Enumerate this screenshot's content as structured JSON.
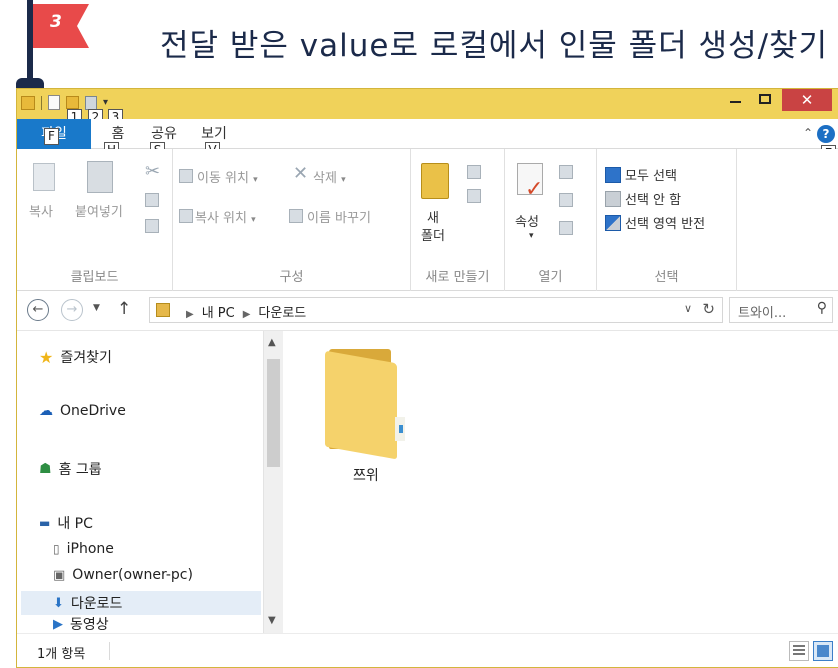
{
  "banner": {
    "step": "3",
    "title": "전달 받은 value로 로컬에서 인물 폴더 생성/찾기"
  },
  "qat": {
    "keytips": [
      "1",
      "2",
      "3"
    ]
  },
  "window_controls": {
    "close_glyph": "✕"
  },
  "tabs": {
    "file": "파일",
    "file_keytip": "F",
    "home": "홈",
    "home_keytip": "H",
    "share": "공유",
    "share_keytip": "S",
    "view": "보기",
    "view_keytip": "V",
    "help_keytip": "E"
  },
  "ribbon": {
    "clipboard": {
      "label": "클립보드",
      "copy": "복사",
      "paste": "붙여넣기"
    },
    "organize": {
      "label": "구성",
      "move_to": "이동 위치",
      "copy_to": "복사 위치",
      "delete": "삭제",
      "rename": "이름 바꾸기"
    },
    "new": {
      "label": "새로 만들기",
      "new_folder_line1": "새",
      "new_folder_line2": "폴더"
    },
    "open": {
      "label": "열기",
      "properties": "속성"
    },
    "select": {
      "label": "선택",
      "select_all": "모두 선택",
      "select_none": "선택 안 함",
      "invert": "선택 영역 반전"
    }
  },
  "address": {
    "crumbs": [
      "내 PC",
      "다운로드"
    ],
    "search_placeholder": "트와이..."
  },
  "nav_pane": {
    "favorites": "즐겨찾기",
    "onedrive": "OneDrive",
    "homegroup": "홈 그룹",
    "this_pc": "내 PC",
    "iphone": "iPhone",
    "owner_pc": "Owner(owner-pc)",
    "downloads": "다운로드",
    "videos": "동영상"
  },
  "files": [
    {
      "name": "쯔위",
      "type": "folder"
    }
  ],
  "status": {
    "count": "1개 항목"
  },
  "colors": {
    "title_bar": "#f0d25a",
    "file_tab": "#1979ca",
    "close_button": "#c94343",
    "flag": "#e84a4a"
  }
}
